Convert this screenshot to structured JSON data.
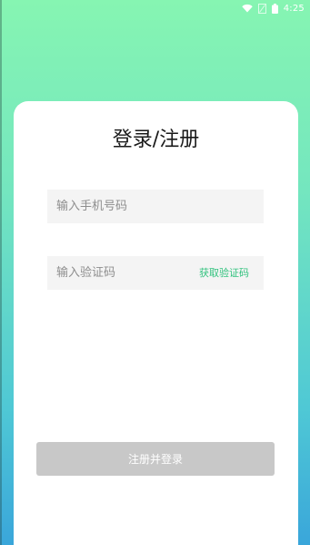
{
  "status_bar": {
    "time": "4:25",
    "icons": [
      "wifi-icon",
      "signal-off-icon",
      "battery-icon"
    ]
  },
  "login": {
    "title": "登录/注册",
    "phone_placeholder": "输入手机号码",
    "code_placeholder": "输入验证码",
    "get_code_label": "获取验证码",
    "submit_label": "注册并登录"
  },
  "colors": {
    "gradient_top": "#86f5b2",
    "gradient_bottom": "#3aa6da",
    "accent": "#32c27e",
    "disabled_button": "#c8c8c8",
    "field_bg": "#f4f4f4"
  }
}
